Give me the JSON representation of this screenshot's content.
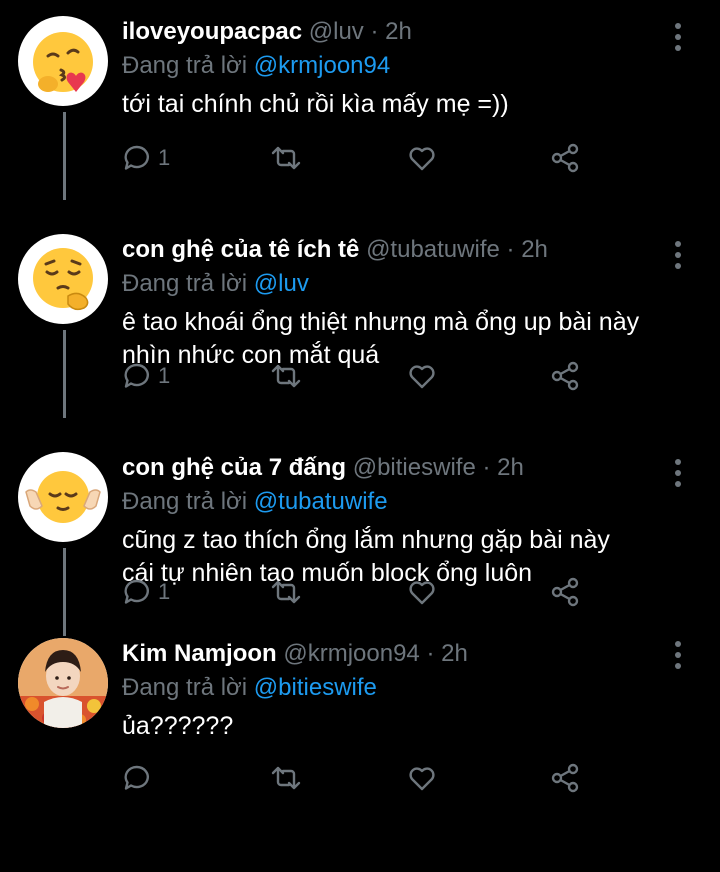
{
  "colors": {
    "background": "#000000",
    "text": "#ffffff",
    "muted": "#6e767d",
    "link": "#1d9bf0"
  },
  "tweets": [
    {
      "display_name": "iloveyoupacpac",
      "handle": "@luv",
      "dot": "·",
      "time": "2h",
      "reply_prefix": "Đang trả lời",
      "reply_to": "@krmjoon94",
      "text_lines": [
        "tới tai chính chủ rồi kìa mấy mẹ =))"
      ],
      "reply_count": "1",
      "avatar_icon": "kissing-face-heart-emoji"
    },
    {
      "display_name": "con ghệ của tê ích tê",
      "handle": "@tubatuwife",
      "dot": "·",
      "time": "2h",
      "reply_prefix": "Đang trả lời",
      "reply_to": "@luv",
      "text_lines": [
        "ê tao khoái ổng thiệt nhưng mà ổng up bài này",
        "nhìn nhức con mắt quá"
      ],
      "reply_count": "1",
      "avatar_icon": "pleading-hand-face-emoji"
    },
    {
      "display_name": "con ghệ của 7 đấng",
      "handle": "@bitieswife",
      "dot": "·",
      "time": "2h",
      "reply_prefix": "Đang trả lời",
      "reply_to": "@tubatuwife",
      "text_lines": [
        "cũng z tao thích ổng lắm nhưng gặp bài này",
        "cái tự nhiên tao muốn block ổng luôn"
      ],
      "reply_count": "1",
      "avatar_icon": "pensive-hands-face-emoji"
    },
    {
      "display_name": "Kim Namjoon",
      "handle": "@krmjoon94",
      "dot": "·",
      "time": "2h",
      "reply_prefix": "Đang trả lời",
      "reply_to": "@bitieswife",
      "text_lines": [
        "ủa??????"
      ],
      "reply_count": "",
      "avatar_icon": "person-photo"
    }
  ]
}
